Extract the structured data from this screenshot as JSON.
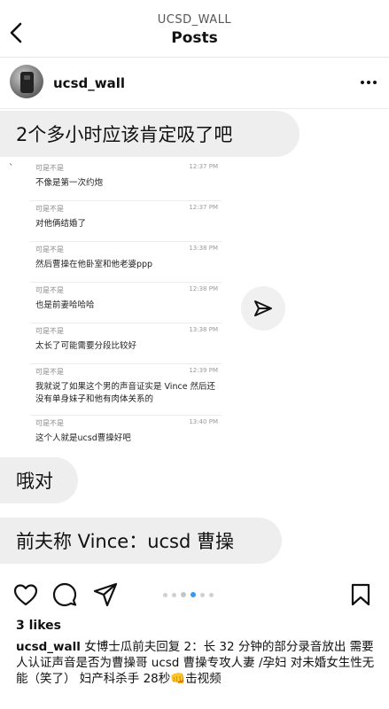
{
  "header": {
    "account": "UCSD_WALL",
    "title": "Posts"
  },
  "post": {
    "username": "ucsd_wall"
  },
  "image": {
    "bubble_1": "2个多小时应该肯定吸了吧",
    "tick_mark": "`",
    "messages": [
      {
        "sender": "可是不是",
        "time": "12:37 PM",
        "text": "不像是第一次约炮"
      },
      {
        "sender": "可是不是",
        "time": "12:37 PM",
        "text": "对他俩结婚了"
      },
      {
        "sender": "可是不是",
        "time": "13:38 PM",
        "text": "然后曹操在他卧室和他老婆ppp"
      },
      {
        "sender": "可是不是",
        "time": "12:38 PM",
        "text": "也是前妻哈哈哈"
      },
      {
        "sender": "可是不是",
        "time": "13:38 PM",
        "text": "太长了可能需要分段比较好"
      },
      {
        "sender": "可是不是",
        "time": "12:39 PM",
        "text": "我就说了如果这个男的声音证实是 Vince 然后还没有单身妹子和他有肉体关系的"
      },
      {
        "sender": "可是不是",
        "time": "13:40 PM",
        "text": "这个人就是ucsd曹操好吧"
      }
    ],
    "bubble_2": "哦对",
    "bubble_3": "前夫称 Vince：ucsd 曹操"
  },
  "actions": {
    "icons": [
      "heart-icon",
      "comment-icon",
      "share-icon",
      "bookmark-icon"
    ],
    "carousel_total": 6,
    "carousel_active_index": 3,
    "carousel_active_color": "#3897f0"
  },
  "likes": "3 likes",
  "caption": {
    "username": "ucsd_wall",
    "text": " 女博士瓜前夫回复 2：长 32 分钟的部分录音放出 需要人认证声音是否为曹操哥 ucsd 曹操专攻人妻 /孕妇 对未婚女生性无能（笑了） 妇产科杀手 28秒👊击视频"
  }
}
